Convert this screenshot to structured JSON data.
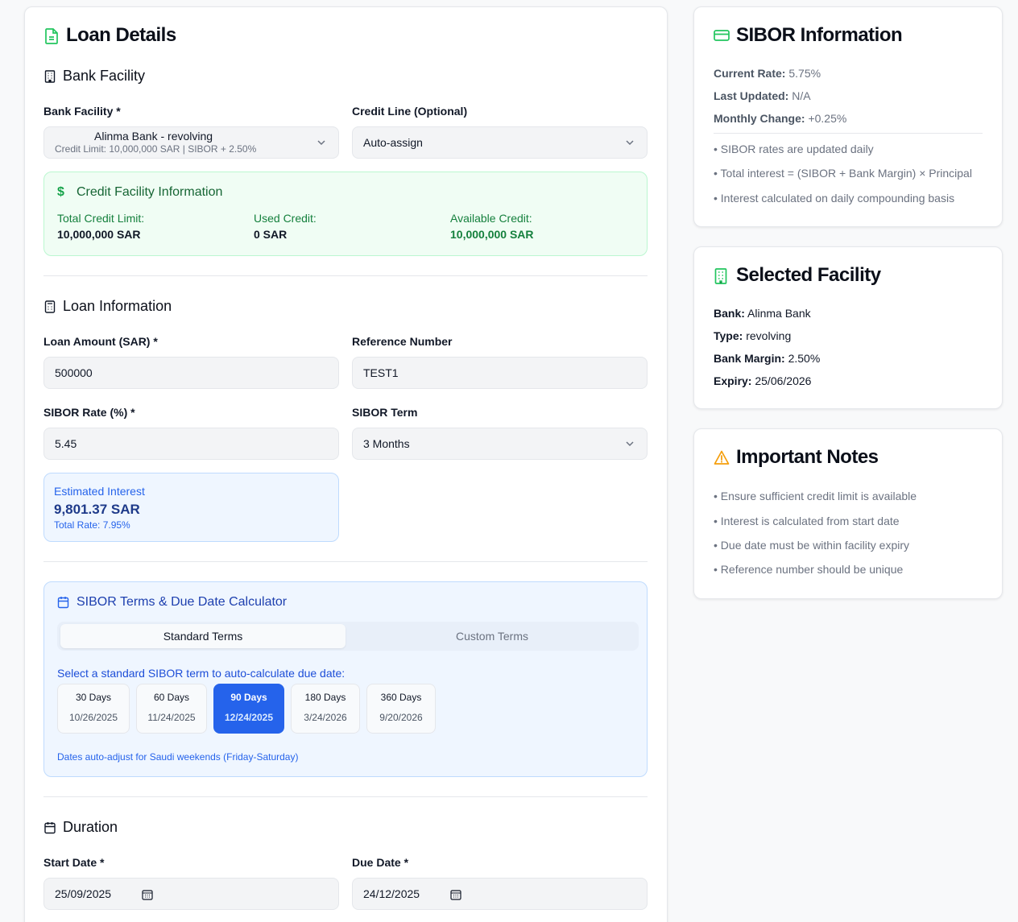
{
  "main": {
    "title": "Loan Details",
    "bank_section": {
      "title": "Bank Facility",
      "bank_label": "Bank Facility *",
      "bank_value": "Alinma Bank - revolving",
      "bank_sub": "Credit Limit: 10,000,000 SAR | SIBOR + 2.50%",
      "credit_label": "Credit Line (Optional)",
      "credit_value": "Auto-assign"
    },
    "facility_info": {
      "title": "Credit Facility Information",
      "total_label": "Total Credit Limit:",
      "total_value": "10,000,000 SAR",
      "used_label": "Used Credit:",
      "used_value": "0 SAR",
      "available_label": "Available Credit:",
      "available_value": "10,000,000 SAR"
    },
    "loan_section": {
      "title": "Loan Information",
      "amount_label": "Loan Amount (SAR) *",
      "amount_value": "500000",
      "ref_label": "Reference Number",
      "ref_value": "TEST1",
      "rate_label": "SIBOR Rate (%) *",
      "rate_value": "5.45",
      "term_label": "SIBOR Term",
      "term_value": "3 Months"
    },
    "estimate": {
      "label": "Estimated Interest",
      "value": "9,801.37 SAR",
      "sub": "Total Rate: 7.95%"
    },
    "calculator": {
      "title": "SIBOR Terms & Due Date Calculator",
      "tab_standard": "Standard Terms",
      "tab_custom": "Custom Terms",
      "instruction": "Select a standard SIBOR term to auto-calculate due date:",
      "terms": [
        {
          "days": "30 Days",
          "date": "10/26/2025"
        },
        {
          "days": "60 Days",
          "date": "11/24/2025"
        },
        {
          "days": "90 Days",
          "date": "12/24/2025"
        },
        {
          "days": "180 Days",
          "date": "3/24/2026"
        },
        {
          "days": "360 Days",
          "date": "9/20/2026"
        }
      ],
      "note": "Dates auto-adjust for Saudi weekends (Friday-Saturday)"
    },
    "duration": {
      "title": "Duration",
      "start_label": "Start Date *",
      "start_value": "25/09/2025",
      "due_label": "Due Date *",
      "due_value": "24/12/2025"
    }
  },
  "sibor_info": {
    "title": "SIBOR Information",
    "current_label": "Current Rate:",
    "current_value": "5.75%",
    "updated_label": "Last Updated:",
    "updated_value": "N/A",
    "change_label": "Monthly Change:",
    "change_value": "+0.25%",
    "bullets": [
      "• SIBOR rates are updated daily",
      "• Total interest = (SIBOR + Bank Margin) × Principal",
      "• Interest calculated on daily compounding basis"
    ]
  },
  "selected_facility": {
    "title": "Selected Facility",
    "bank_label": "Bank:",
    "bank_value": "Alinma Bank",
    "type_label": "Type:",
    "type_value": "revolving",
    "margin_label": "Bank Margin:",
    "margin_value": "2.50%",
    "expiry_label": "Expiry:",
    "expiry_value": "25/06/2026"
  },
  "notes": {
    "title": "Important Notes",
    "bullets": [
      "• Ensure sufficient credit limit is available",
      "• Interest is calculated from start date",
      "• Due date must be within facility expiry",
      "• Reference number should be unique"
    ]
  },
  "colors": {
    "accent_green": "#22c55e",
    "accent_blue": "#2563eb",
    "warning": "#f59e0b"
  }
}
